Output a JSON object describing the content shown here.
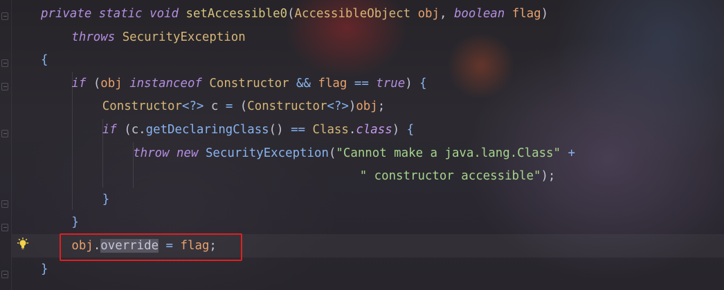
{
  "editor": {
    "lines": [
      {
        "indent": 0,
        "tokens": [
          {
            "t": "private",
            "c": "kw"
          },
          {
            "t": " ",
            "c": "pl"
          },
          {
            "t": "static",
            "c": "kw"
          },
          {
            "t": " ",
            "c": "pl"
          },
          {
            "t": "void",
            "c": "kw"
          },
          {
            "t": " ",
            "c": "pl"
          },
          {
            "t": "setAccessible0",
            "c": "fn"
          },
          {
            "t": "(",
            "c": "pl"
          },
          {
            "t": "AccessibleObject",
            "c": "type"
          },
          {
            "t": " ",
            "c": "pl"
          },
          {
            "t": "obj",
            "c": "param"
          },
          {
            "t": ", ",
            "c": "pl"
          },
          {
            "t": "boolean",
            "c": "kw"
          },
          {
            "t": " ",
            "c": "pl"
          },
          {
            "t": "flag",
            "c": "param"
          },
          {
            "t": ")",
            "c": "pl"
          }
        ]
      },
      {
        "indent": 1,
        "tokens": [
          {
            "t": "throws",
            "c": "kw"
          },
          {
            "t": " ",
            "c": "pl"
          },
          {
            "t": "SecurityException",
            "c": "type"
          }
        ]
      },
      {
        "indent": 0,
        "tokens": [
          {
            "t": "{",
            "c": "op"
          }
        ]
      },
      {
        "indent": 1,
        "tokens": [
          {
            "t": "if",
            "c": "kw"
          },
          {
            "t": " (",
            "c": "pl"
          },
          {
            "t": "obj",
            "c": "param"
          },
          {
            "t": " ",
            "c": "pl"
          },
          {
            "t": "instanceof",
            "c": "kw"
          },
          {
            "t": " ",
            "c": "pl"
          },
          {
            "t": "Constructor",
            "c": "type"
          },
          {
            "t": " ",
            "c": "pl"
          },
          {
            "t": "&&",
            "c": "op"
          },
          {
            "t": " ",
            "c": "pl"
          },
          {
            "t": "flag",
            "c": "param"
          },
          {
            "t": " ",
            "c": "pl"
          },
          {
            "t": "==",
            "c": "op"
          },
          {
            "t": " ",
            "c": "pl"
          },
          {
            "t": "true",
            "c": "kw"
          },
          {
            "t": ") ",
            "c": "pl"
          },
          {
            "t": "{",
            "c": "op"
          }
        ]
      },
      {
        "indent": 2,
        "tokens": [
          {
            "t": "Constructor",
            "c": "type"
          },
          {
            "t": "<?>",
            "c": "op"
          },
          {
            "t": " c ",
            "c": "pl"
          },
          {
            "t": "=",
            "c": "op"
          },
          {
            "t": " (",
            "c": "pl"
          },
          {
            "t": "Constructor",
            "c": "type"
          },
          {
            "t": "<?>",
            "c": "op"
          },
          {
            "t": ")",
            "c": "pl"
          },
          {
            "t": "obj",
            "c": "param"
          },
          {
            "t": ";",
            "c": "pl"
          }
        ]
      },
      {
        "indent": 2,
        "tokens": [
          {
            "t": "if",
            "c": "kw"
          },
          {
            "t": " (c.",
            "c": "pl"
          },
          {
            "t": "getDeclaringClass",
            "c": "op"
          },
          {
            "t": "() ",
            "c": "pl"
          },
          {
            "t": "==",
            "c": "op"
          },
          {
            "t": " ",
            "c": "pl"
          },
          {
            "t": "Class",
            "c": "type"
          },
          {
            "t": ".",
            "c": "pl"
          },
          {
            "t": "class",
            "c": "cls"
          },
          {
            "t": ") ",
            "c": "pl"
          },
          {
            "t": "{",
            "c": "op"
          }
        ]
      },
      {
        "indent": 3,
        "tokens": [
          {
            "t": "throw",
            "c": "kw"
          },
          {
            "t": " ",
            "c": "pl"
          },
          {
            "t": "new",
            "c": "kw"
          },
          {
            "t": " ",
            "c": "pl"
          },
          {
            "t": "SecurityException",
            "c": "op"
          },
          {
            "t": "(",
            "c": "pl"
          },
          {
            "t": "\"Cannot make a java.lang.Class\"",
            "c": "str"
          },
          {
            "t": " ",
            "c": "pl"
          },
          {
            "t": "+",
            "c": "op"
          }
        ]
      },
      {
        "indent": 0,
        "pad": "                                            ",
        "tokens": [
          {
            "t": "\" constructor accessible\"",
            "c": "str"
          },
          {
            "t": ");",
            "c": "pl"
          }
        ]
      },
      {
        "indent": 2,
        "tokens": [
          {
            "t": "}",
            "c": "op"
          }
        ]
      },
      {
        "indent": 1,
        "tokens": [
          {
            "t": "}",
            "c": "op"
          }
        ]
      },
      {
        "indent": 1,
        "tokens": [
          {
            "t": "obj",
            "c": "param"
          },
          {
            "t": ".",
            "c": "pl"
          },
          {
            "t": "override",
            "c": "pl",
            "hl": true
          },
          {
            "t": " ",
            "c": "pl"
          },
          {
            "t": "=",
            "c": "op"
          },
          {
            "t": " ",
            "c": "pl"
          },
          {
            "t": "flag",
            "c": "param"
          },
          {
            "t": ";",
            "c": "pl"
          }
        ]
      },
      {
        "indent": 0,
        "tokens": [
          {
            "t": "}",
            "c": "op"
          }
        ]
      }
    ]
  },
  "icons": {
    "bulb": "lightbulb-icon",
    "fold": "fold-marker-icon"
  },
  "colors": {
    "keyword": "#b48ee0",
    "type": "#d6b678",
    "param": "#e8a26e",
    "string": "#a6d48c",
    "operator": "#89b4f0",
    "highlight_border": "#e02020"
  }
}
